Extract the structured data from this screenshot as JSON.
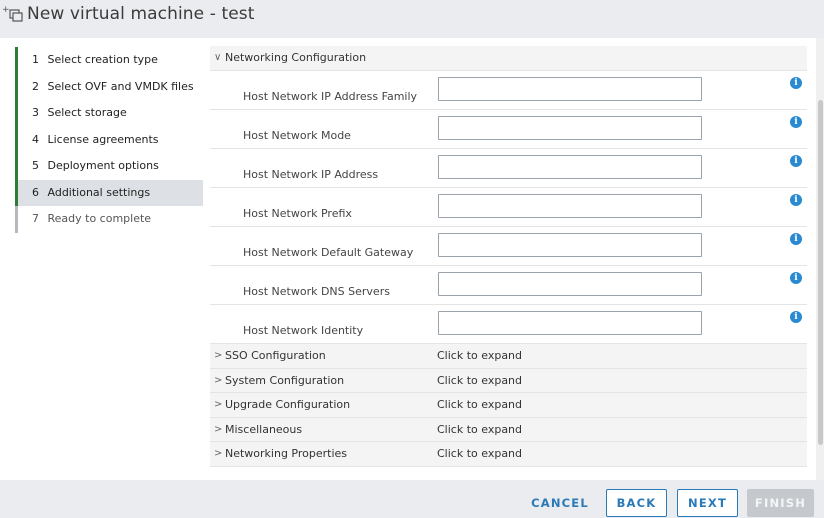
{
  "window": {
    "title": "New virtual machine - test",
    "icon": "new-vm-icon"
  },
  "steps": [
    {
      "num": "1",
      "label": "Select creation type",
      "state": "done"
    },
    {
      "num": "2",
      "label": "Select OVF and VMDK files",
      "state": "done"
    },
    {
      "num": "3",
      "label": "Select storage",
      "state": "done"
    },
    {
      "num": "4",
      "label": "License agreements",
      "state": "done"
    },
    {
      "num": "5",
      "label": "Deployment options",
      "state": "done"
    },
    {
      "num": "6",
      "label": "Additional settings",
      "state": "active"
    },
    {
      "num": "7",
      "label": "Ready to complete",
      "state": "upcoming"
    }
  ],
  "networking": {
    "section_label": "Networking Configuration",
    "expanded": true,
    "fields": [
      {
        "label": "Host Network IP Address Family",
        "value": "",
        "info_icon": "info-icon"
      },
      {
        "label": "Host Network Mode",
        "value": "",
        "info_icon": "info-icon"
      },
      {
        "label": "Host Network IP Address",
        "value": "",
        "info_icon": "info-icon"
      },
      {
        "label": "Host Network Prefix",
        "value": "",
        "info_icon": "info-icon"
      },
      {
        "label": "Host Network Default Gateway",
        "value": "",
        "info_icon": "info-icon"
      },
      {
        "label": "Host Network DNS Servers",
        "value": "",
        "info_icon": "info-icon"
      },
      {
        "label": "Host Network Identity",
        "value": "",
        "info_icon": "info-icon"
      }
    ]
  },
  "collapsed_sections": [
    {
      "label": "SSO Configuration",
      "hint": "Click to expand"
    },
    {
      "label": "System Configuration",
      "hint": "Click to expand"
    },
    {
      "label": "Upgrade Configuration",
      "hint": "Click to expand"
    },
    {
      "label": "Miscellaneous",
      "hint": "Click to expand"
    },
    {
      "label": "Networking Properties",
      "hint": "Click to expand"
    }
  ],
  "footer": {
    "cancel": "CANCEL",
    "back": "BACK",
    "next": "NEXT",
    "finish": "FINISH"
  },
  "colors": {
    "accent": "#2a7ab8",
    "step_done": "#2f7d32",
    "info": "#2a8ad1",
    "finish_disabled": "#c5c9cd"
  }
}
